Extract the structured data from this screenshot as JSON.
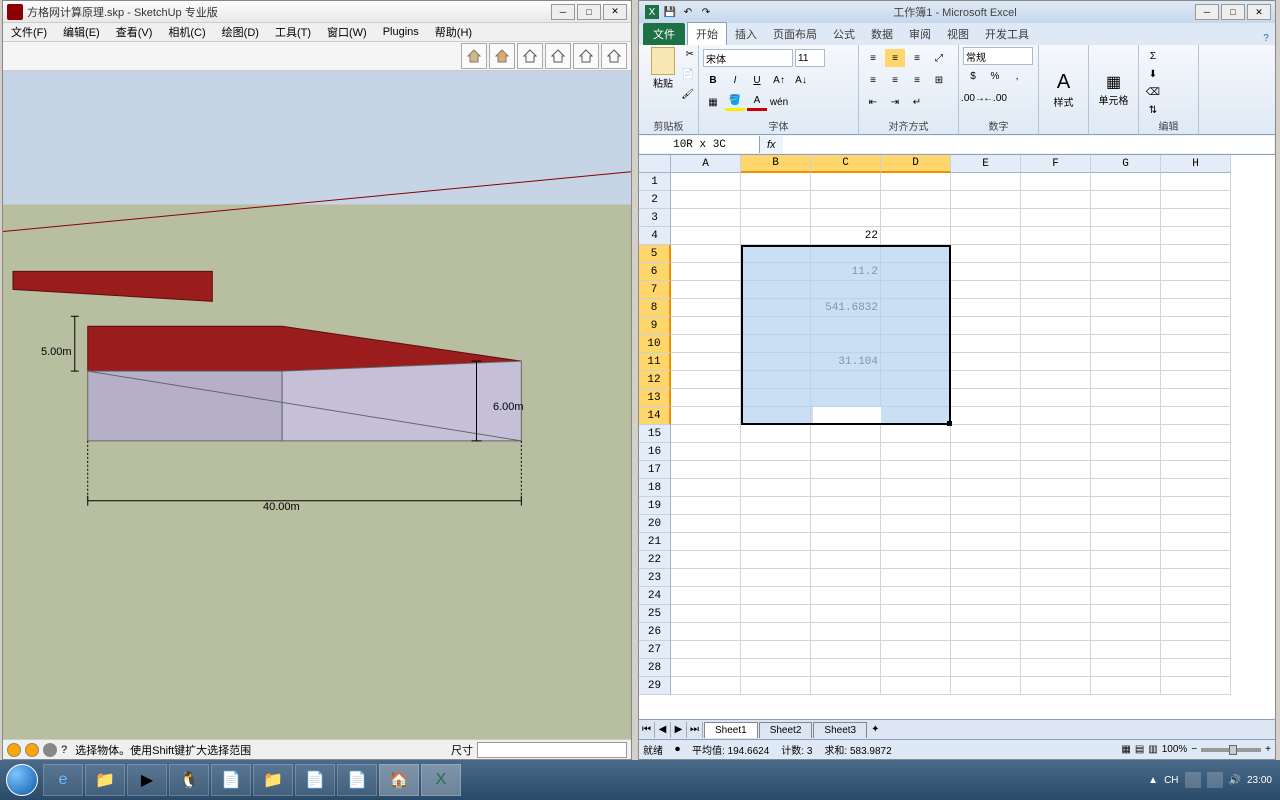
{
  "sketchup": {
    "title": "方格网计算原理.skp - SketchUp 专业版",
    "menu": [
      "文件(F)",
      "编辑(E)",
      "查看(V)",
      "相机(C)",
      "绘图(D)",
      "工具(T)",
      "窗口(W)",
      "Plugins",
      "帮助(H)"
    ],
    "dims": {
      "height_left": "5.00m",
      "height_right": "6.00m",
      "width": "40.00m"
    },
    "status": "选择物体。使用Shift键扩大选择范围",
    "size_label": "尺寸"
  },
  "excel": {
    "title": "工作簿1 - Microsoft Excel",
    "tabs": {
      "file": "文件",
      "list": [
        "开始",
        "插入",
        "页面布局",
        "公式",
        "数据",
        "审阅",
        "视图",
        "开发工具"
      ],
      "active": "开始"
    },
    "ribbon_groups": [
      "剪贴板",
      "字体",
      "对齐方式",
      "数字",
      "样式",
      "单元格",
      "编辑"
    ],
    "paste": "粘贴",
    "font_name": "宋体",
    "font_size": "11",
    "number_fmt": "常规",
    "styles_btn": "样式",
    "cells_btn": "单元格",
    "namebox": "10R x 3C",
    "columns": [
      "A",
      "B",
      "C",
      "D",
      "E",
      "F",
      "G",
      "H"
    ],
    "selected_cols": [
      "B",
      "C",
      "D"
    ],
    "rows": [
      "1",
      "2",
      "3",
      "4",
      "5",
      "6",
      "7",
      "8",
      "9",
      "10",
      "11",
      "12",
      "13",
      "14",
      "15",
      "16",
      "17",
      "18",
      "19",
      "20",
      "21",
      "22",
      "23",
      "24",
      "25",
      "26",
      "27",
      "28",
      "29"
    ],
    "selected_rows": [
      "5",
      "6",
      "7",
      "8",
      "9",
      "10",
      "11",
      "12",
      "13",
      "14"
    ],
    "cell_data": {
      "C4": "22",
      "C6": "11.2",
      "C8": "541.6832",
      "C11": "31.104"
    },
    "sheets": [
      "Sheet1",
      "Sheet2",
      "Sheet3"
    ],
    "status": {
      "ready": "就绪",
      "avg": "平均值: 194.6624",
      "count": "计数: 3",
      "sum": "求和: 583.9872",
      "zoom": "100%"
    }
  },
  "taskbar": {
    "time": "23:00",
    "ime": "CH"
  }
}
